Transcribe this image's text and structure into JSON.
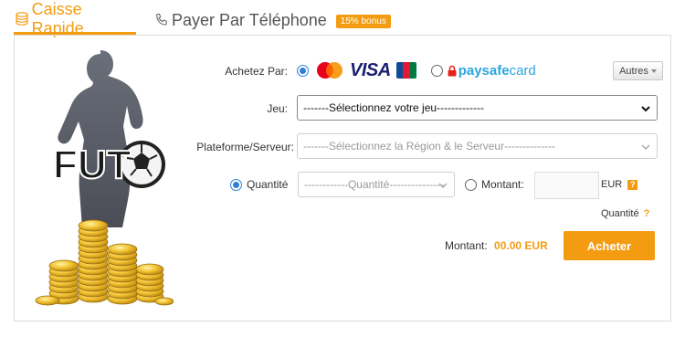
{
  "tabs": {
    "caisse": {
      "label": "Caisse Rapide"
    },
    "phone": {
      "label": "Payer Par Téléphone",
      "badge": "15% bonus"
    }
  },
  "brand": {
    "logo_text": "FUT"
  },
  "form": {
    "payment_label": "Achetez Par:",
    "payment_options": {
      "cards": {
        "visa_text": "VISA",
        "jcb_text": "JCB",
        "selected": true
      },
      "paysafe": {
        "text_bold": "paysafe",
        "text_light": "card",
        "selected": false
      }
    },
    "autres_label": "Autres",
    "game_label": "Jeu:",
    "game_select": "-------Sélectionnez votre jeu-------------",
    "platform_label": "Plateforme/Serveur:",
    "platform_select": "-------Sélectionnez la Région & le Serveur--------------",
    "quantity_radio_label": "Quantité",
    "quantity_select": "------------Quantité---------------",
    "amount_radio_label": "Montant:",
    "currency": "EUR",
    "help_glyph": "?",
    "quantity_link": "Quantité",
    "total_label": "Montant:",
    "total_value": "00.00 EUR",
    "buy_label": "Acheter"
  },
  "colors": {
    "accent": "#f39c12",
    "radio_blue": "#2f7fd8",
    "paysafe_red": "#e2231a"
  }
}
